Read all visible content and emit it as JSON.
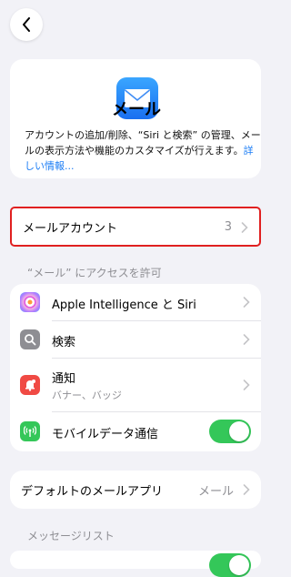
{
  "nav": {
    "back_icon": "chevron-left-icon"
  },
  "app": {
    "icon": "mail-envelope-icon",
    "title": "メール",
    "description": "アカウントの追加/削除、“Siri と検索” の管理、メールの表示方法や機能のカスタマイズが行えます。",
    "link": "詳しい情報..."
  },
  "mail_accounts": {
    "label": "メールアカウント",
    "count": "3"
  },
  "access_section": {
    "header": "“メール” にアクセスを許可",
    "items": [
      {
        "label": "Apple Intelligence と Siri",
        "icon": "apple-intelligence-icon"
      },
      {
        "label": "検索",
        "icon": "search-icon"
      },
      {
        "label": "通知",
        "sublabel": "バナー、バッジ",
        "icon": "notification-icon"
      },
      {
        "label": "モバイルデータ通信",
        "icon": "cellular-antenna-icon",
        "toggle_on": true
      }
    ]
  },
  "default_app": {
    "label": "デフォルトのメールアプリ",
    "value": "メール"
  },
  "message_list": {
    "header": "メッセージリスト"
  },
  "colors": {
    "accent": "#1a7cf5",
    "toggle": "#34c759",
    "highlight_border": "#e02020"
  }
}
